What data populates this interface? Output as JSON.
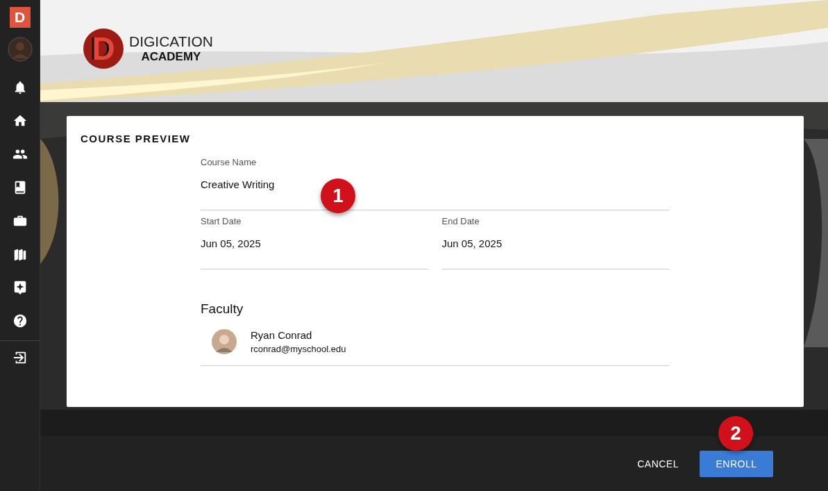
{
  "sidebar": {
    "app_letter": "D",
    "nav": [
      {
        "kind": "avatar"
      },
      {
        "kind": "bell"
      },
      {
        "kind": "home"
      },
      {
        "kind": "people"
      },
      {
        "kind": "book"
      },
      {
        "kind": "briefcase"
      },
      {
        "kind": "books"
      },
      {
        "kind": "sparkle"
      },
      {
        "kind": "help"
      },
      {
        "kind": "logout"
      }
    ]
  },
  "banner": {
    "logo_mark": "D",
    "logo_line_1": "DIGICATION",
    "logo_line_2": "ACADEMY"
  },
  "card": {
    "title": "COURSE PREVIEW",
    "course_name": {
      "label": "Course Name",
      "value": "Creative Writing"
    },
    "start_date": {
      "label": "Start Date",
      "value": "Jun 05, 2025"
    },
    "end_date": {
      "label": "End Date",
      "value": "Jun 05, 2025"
    },
    "faculty_heading": "Faculty",
    "faculty": [
      {
        "name": "Ryan Conrad",
        "email": "rconrad@myschool.edu"
      }
    ]
  },
  "callouts": [
    "1",
    "2"
  ],
  "buttons": {
    "cancel": "CANCEL",
    "enroll": "ENROLL"
  }
}
